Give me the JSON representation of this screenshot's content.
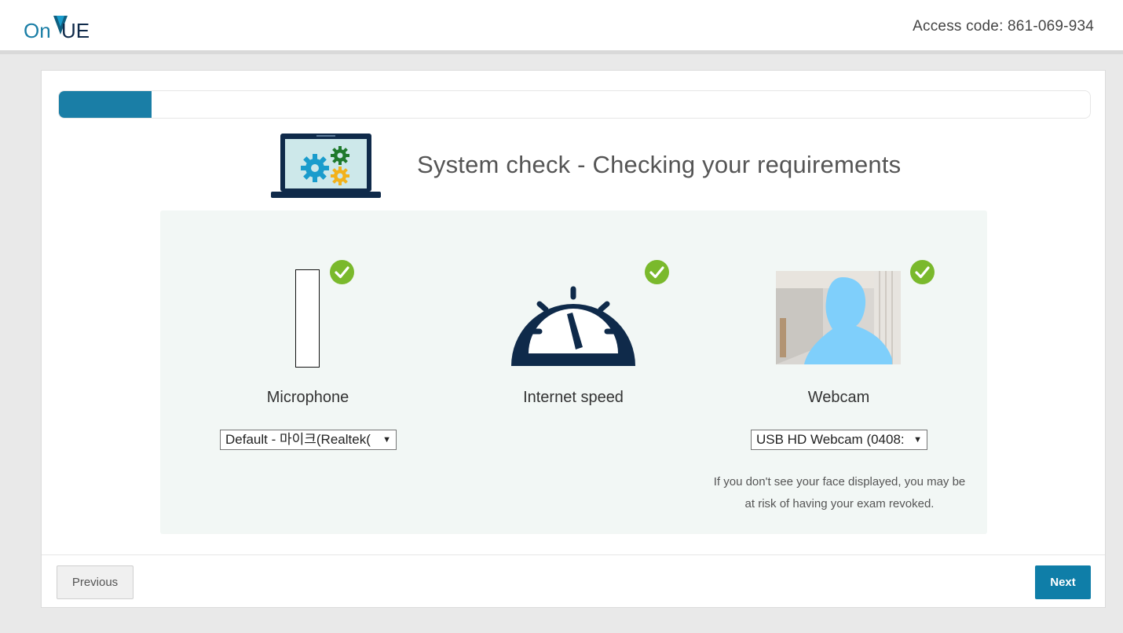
{
  "header": {
    "logo_text": "OnVUE",
    "access_code": "Access code: 861-069-934"
  },
  "progress": {
    "fraction": 0.09
  },
  "page": {
    "title": "System check - Checking your requirements"
  },
  "checks": {
    "microphone": {
      "label": "Microphone",
      "status": "passed",
      "selected_device": "Default - 마이크(Realtek("
    },
    "internet": {
      "label": "Internet speed",
      "status": "passed"
    },
    "webcam": {
      "label": "Webcam",
      "status": "passed",
      "selected_device": "USB HD Webcam (0408:"
    }
  },
  "warning": {
    "line1": "If you don't see your face displayed, you may be",
    "line2": "at risk of having your exam revoked."
  },
  "footer": {
    "previous_label": "Previous",
    "next_label": "Next"
  },
  "colors": {
    "brand_teal": "#1a7ea6",
    "check_green": "#7ab92c",
    "gauge_navy": "#0f2a4a",
    "panel_bg": "#f2f7f5",
    "face_mask": "#7fcffb"
  },
  "icons": {
    "status": "checkmark-circle-icon",
    "internet": "speedometer-icon",
    "system": "laptop-gears-icon"
  }
}
